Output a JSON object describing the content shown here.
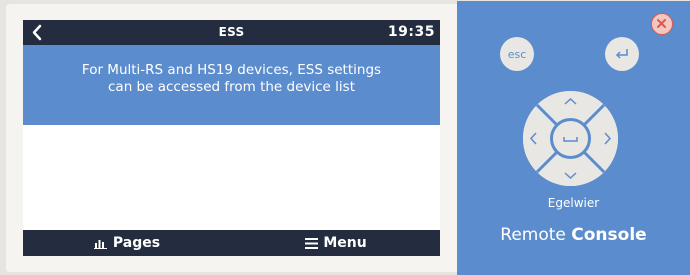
{
  "screen": {
    "title": "ESS",
    "time": "19:35",
    "message_line1": "For Multi-RS and HS19 devices, ESS settings",
    "message_line2": "can be accessed from the device list"
  },
  "bottom_bar": {
    "pages_label": "Pages",
    "menu_label": "Menu"
  },
  "remote_panel": {
    "esc_label": "esc",
    "device_name": "Egelwier",
    "brand_prefix": "Remote",
    "brand_suffix": "Console"
  },
  "colors": {
    "accent_blue": "#5b8ccd",
    "dark_bar": "#232d3f",
    "key_fill": "#e9e7e3",
    "close_red": "#e05848"
  },
  "icons": [
    "back-arrow-icon",
    "bar-chart-icon",
    "hamburger-menu-icon",
    "close-icon",
    "enter-icon",
    "arrow-up-icon",
    "arrow-down-icon",
    "arrow-left-icon",
    "arrow-right-icon",
    "space-icon"
  ]
}
